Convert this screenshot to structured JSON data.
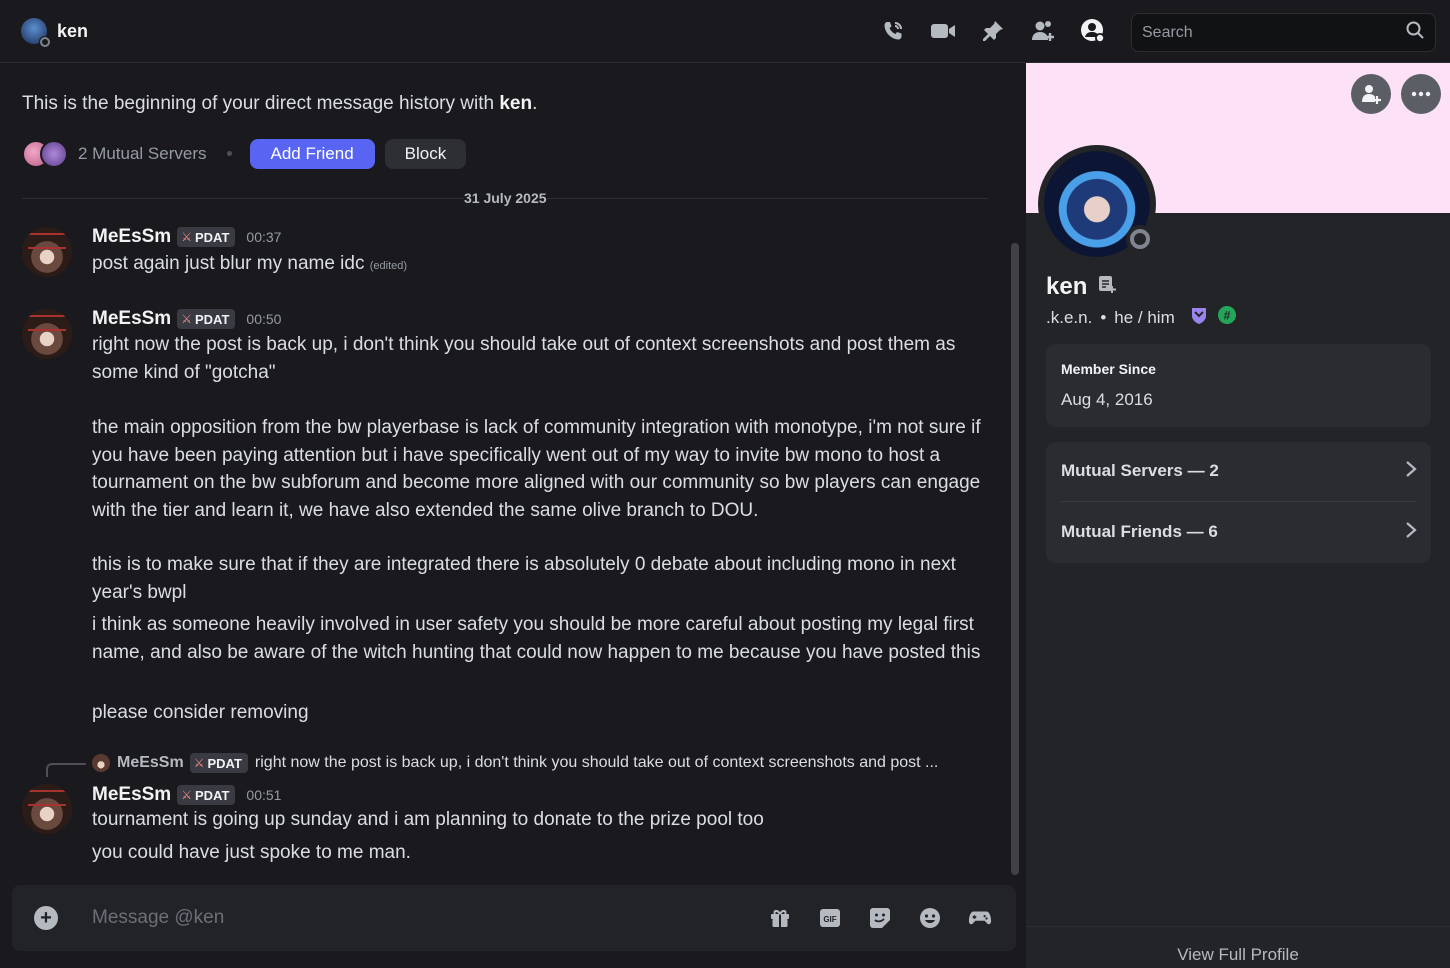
{
  "header": {
    "channel_name": "ken",
    "search_placeholder": "Search",
    "icons": [
      "phone-icon",
      "video-camera-icon",
      "pin-icon",
      "add-friends-to-dm-icon",
      "user-profile-icon",
      "search-icon"
    ]
  },
  "intro": {
    "text": "This is the beginning of your direct message history with ",
    "name": "ken",
    "end": ".",
    "mutual_servers": "2 Mutual Servers",
    "add_friend": "Add Friend",
    "block": "Block"
  },
  "date_divider": "31 July 2025",
  "messages": [
    {
      "author": "MeEsSm",
      "tag": "PDAT",
      "time": "00:37",
      "body": "post again just blur my name idc",
      "edited": "(edited)"
    },
    {
      "author": "MeEsSm",
      "tag": "PDAT",
      "time": "00:50",
      "paragraphs": [
        "right now the post is back up, i don't think you should take out of context screenshots and post them as some kind of \"gotcha\"",
        "the main opposition from the bw playerbase is lack of community integration with monotype, i'm not sure if you have been paying attention but i have specifically went out of my way to invite bw mono to host a tournament on the bw subforum and become more aligned with our community so bw players can engage with the tier and learn it, we have also extended the same olive branch to DOU.",
        "this is to make sure that if they are integrated there is absolutely 0 debate about including mono in next year's bwpl",
        "i think as someone heavily involved in user safety you should be more careful about posting my legal first name, and also be aware of the witch hunting that could now happen to me because you have posted this",
        "please consider removing"
      ]
    },
    {
      "reply_author": "MeEsSm",
      "reply_tag": "PDAT",
      "reply_text": "right now the post is back up, i don't think you should take out of context screenshots and post ...",
      "author": "MeEsSm",
      "tag": "PDAT",
      "time": "00:51",
      "paragraphs": [
        "tournament is going up sunday and i am planning to donate to the prize pool too",
        "you could have just spoke to me man."
      ]
    }
  ],
  "composer": {
    "placeholder": "Message @ken",
    "icons": [
      "gift-icon",
      "gif-icon",
      "sticker-icon",
      "emoji-icon",
      "activity-icon"
    ]
  },
  "profile": {
    "banner_color": "#fde1f6",
    "display_name": "ken",
    "username": ".k.e.n.",
    "separator": "•",
    "pronouns": "he / him",
    "member_since_label": "Member Since",
    "member_since_value": "Aug 4, 2016",
    "mutual_servers": "Mutual Servers — 2",
    "mutual_friends": "Mutual Friends — 6",
    "view_full_profile": "View Full Profile"
  },
  "colors": {
    "accent": "#5865f2",
    "background": "#1a1a1e",
    "panel": "#232428"
  }
}
